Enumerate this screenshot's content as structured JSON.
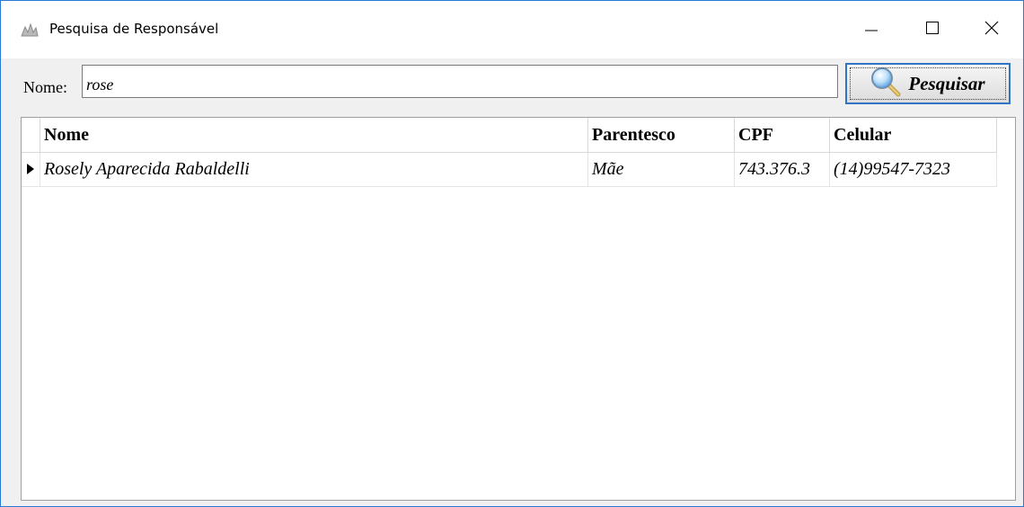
{
  "window": {
    "title": "Pesquisa de Responsável"
  },
  "icons": {
    "app": "app-icon",
    "minimize": "minimize-icon",
    "maximize": "maximize-icon",
    "close": "close-icon",
    "search": "magnifier-icon",
    "row_pointer": "row-pointer-icon"
  },
  "search": {
    "label": "Nome:",
    "value": "rose",
    "button_label": "Pesquisar"
  },
  "grid": {
    "columns": [
      "Nome",
      "Parentesco",
      "CPF",
      "Celular"
    ],
    "rows": [
      {
        "nome": "Rosely Aparecida Rabaldelli",
        "parentesco": "Mãe",
        "cpf": "743.376.3",
        "celular": "(14)99547-7323"
      }
    ]
  },
  "colors": {
    "window_border": "#2b79d6",
    "button_focus_border": "#2f75c4",
    "background": "#f0f0f0"
  }
}
